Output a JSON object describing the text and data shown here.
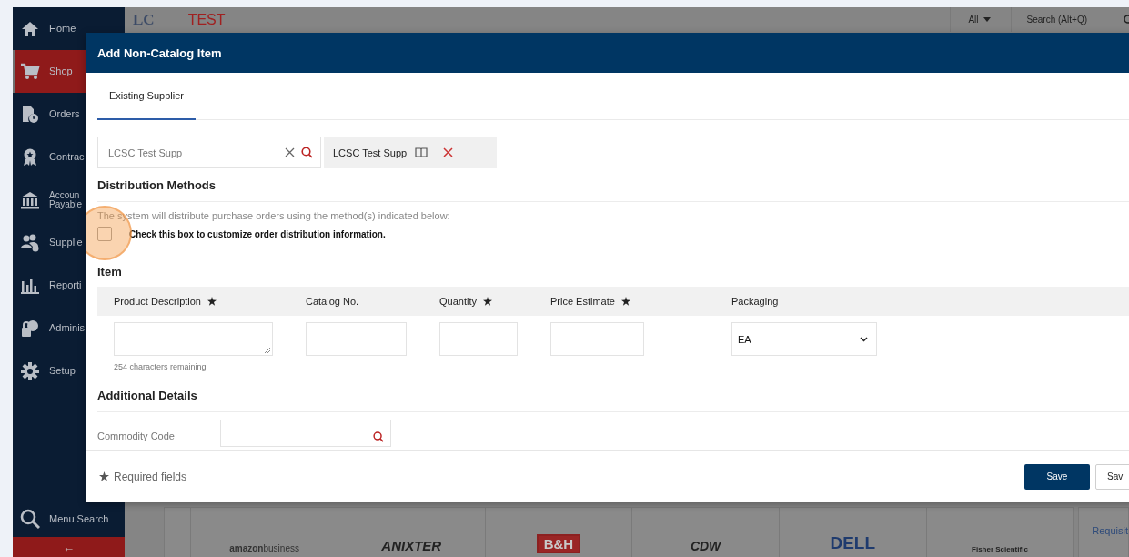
{
  "top_bar": {
    "logo": "LC",
    "env_label": "TEST",
    "scope_menu": "All",
    "search_placeholder": "Search (Alt+Q)"
  },
  "sidebar": {
    "items": [
      {
        "lines": [
          "Home"
        ],
        "selected": false
      },
      {
        "lines": [
          "Shop"
        ],
        "selected": true
      },
      {
        "lines": [
          "Orders"
        ],
        "selected": false
      },
      {
        "lines": [
          "Contrac"
        ],
        "selected": false
      },
      {
        "lines": [
          "Accoun",
          "Payable"
        ],
        "selected": false
      },
      {
        "lines": [
          "Supplie"
        ],
        "selected": false
      },
      {
        "lines": [
          "Reporti"
        ],
        "selected": false
      },
      {
        "lines": [
          "Adminis"
        ],
        "selected": false
      },
      {
        "lines": [
          "Setup"
        ],
        "selected": false
      }
    ],
    "menu_search": "Menu Search",
    "collapse": "←"
  },
  "dialog": {
    "title": "Add Non-Catalog Item",
    "tabs": [
      {
        "label": "Existing Supplier",
        "selected": true
      }
    ],
    "supplier_search": {
      "value": "LCSC Test Supp"
    },
    "supplier_chip": {
      "label": "LCSC Test Supp"
    },
    "distribution": {
      "heading": "Distribution Methods",
      "note": "The system will distribute purchase orders using the method(s) indicated below:",
      "customize": {
        "label": "Check this box to customize order distribution information.",
        "checked": false
      }
    },
    "item": {
      "heading": "Item",
      "columns": [
        {
          "label": "Product Description",
          "required": true,
          "kind": "textarea"
        },
        {
          "label": "Catalog No.",
          "required": false,
          "kind": "text"
        },
        {
          "label": "Quantity",
          "required": true,
          "kind": "text"
        },
        {
          "label": "Price Estimate",
          "required": true,
          "kind": "text"
        },
        {
          "label": "Packaging",
          "required": false,
          "kind": "select",
          "value": "EA"
        }
      ],
      "chars_remaining": "254 characters remaining"
    },
    "additional": {
      "heading": "Additional Details",
      "fields": [
        {
          "label": "Commodity Code"
        }
      ]
    },
    "footer": {
      "required_note": "Required fields",
      "buttons": [
        {
          "label": "Save",
          "kind": "primary"
        },
        {
          "label": "Sav",
          "kind": "secondary"
        }
      ]
    }
  },
  "supplier_logos": [
    "**amazon**business",
    "ANIXTER",
    "B&H",
    "CDW",
    "DELL",
    "Fisher Scientific"
  ],
  "side_link": "Requisit"
}
